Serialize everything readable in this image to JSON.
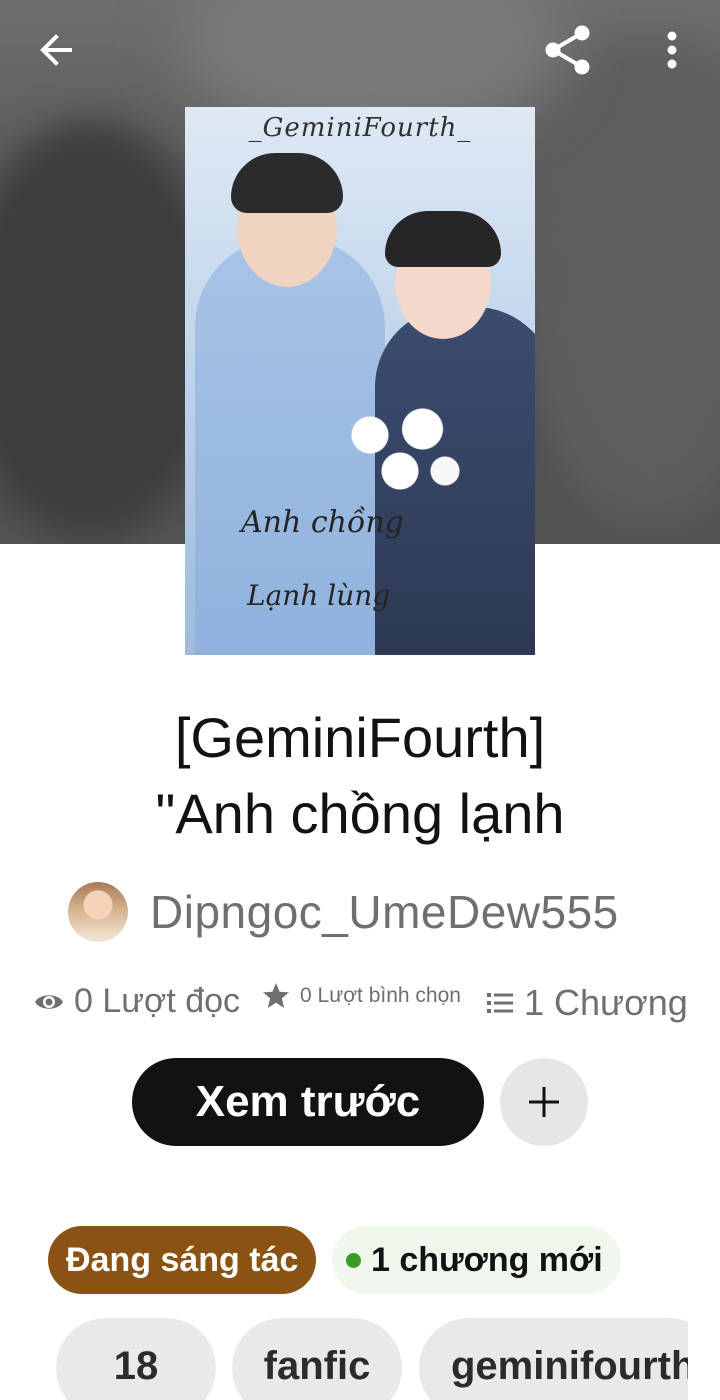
{
  "header": {
    "back_icon": "arrow-left-icon",
    "share_icon": "share-icon",
    "more_icon": "more-vertical-icon"
  },
  "cover": {
    "title_text": "_GeminiFourth_",
    "subtitle_line1": "Anh chồng",
    "subtitle_line2": "Lạnh lùng"
  },
  "story": {
    "title_line1": "[GeminiFourth]",
    "title_line2": "\"Anh chồng lạnh",
    "author": "Dipngoc_UmeDew555"
  },
  "stats": {
    "reads": "0 Lượt đọc",
    "votes": "0 Lượt bình chọn",
    "parts": "1 Chương"
  },
  "actions": {
    "preview_label": "Xem trước",
    "add_icon": "plus-icon"
  },
  "badges": {
    "status": "Đang sáng tác",
    "new_parts": "1 chương mới"
  },
  "tags": [
    "18",
    "fanfic",
    "geminifourth"
  ],
  "colors": {
    "status_badge": "#8a5313",
    "new_dot": "#3a9d21",
    "primary_button": "#121212"
  }
}
